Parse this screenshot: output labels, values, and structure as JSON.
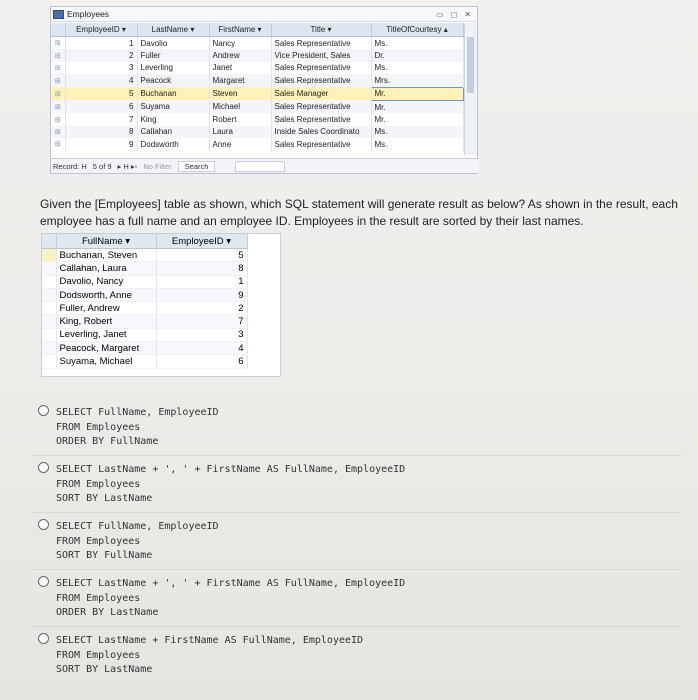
{
  "access": {
    "window_title": "Employees",
    "columns": [
      "EmployeeID",
      "LastName",
      "FirstName",
      "Title",
      "TitleOfCourtesy"
    ],
    "rows": [
      {
        "id": "1",
        "last": "Davolio",
        "first": "Nancy",
        "title": "Sales Representative",
        "courtesy": "Ms."
      },
      {
        "id": "2",
        "last": "Fuller",
        "first": "Andrew",
        "title": "Vice President, Sales",
        "courtesy": "Dr."
      },
      {
        "id": "3",
        "last": "Leverling",
        "first": "Janet",
        "title": "Sales Representative",
        "courtesy": "Ms."
      },
      {
        "id": "4",
        "last": "Peacock",
        "first": "Margaret",
        "title": "Sales Representative",
        "courtesy": "Mrs."
      },
      {
        "id": "5",
        "last": "Buchanan",
        "first": "Steven",
        "title": "Sales Manager",
        "courtesy": "Mr."
      },
      {
        "id": "6",
        "last": "Suyama",
        "first": "Michael",
        "title": "Sales Representative",
        "courtesy": "Mr."
      },
      {
        "id": "7",
        "last": "King",
        "first": "Robert",
        "title": "Sales Representative",
        "courtesy": "Mr."
      },
      {
        "id": "8",
        "last": "Callahan",
        "first": "Laura",
        "title": "Inside Sales Coordinato",
        "courtesy": "Ms."
      },
      {
        "id": "9",
        "last": "Dodsworth",
        "first": "Anne",
        "title": "Sales Representative",
        "courtesy": "Ms."
      }
    ],
    "status": {
      "record_label": "Record: H",
      "position": "5 of 9",
      "nav": "▸ H ▸▫",
      "no_filter": "No Filter",
      "search": "Search"
    }
  },
  "question": "Given the [Employees] table as shown, which SQL statement will generate result as below? As shown in the result, each employee has a full name and an employee ID. Employees in the result are sorted by their last names.",
  "result": {
    "columns": [
      "FullName",
      "EmployeeID"
    ],
    "rows": [
      {
        "name": "Buchanan, Steven",
        "id": "5"
      },
      {
        "name": "Callahan, Laura",
        "id": "8"
      },
      {
        "name": "Davolio, Nancy",
        "id": "1"
      },
      {
        "name": "Dodsworth, Anne",
        "id": "9"
      },
      {
        "name": "Fuller, Andrew",
        "id": "2"
      },
      {
        "name": "King, Robert",
        "id": "7"
      },
      {
        "name": "Leverling, Janet",
        "id": "3"
      },
      {
        "name": "Peacock, Margaret",
        "id": "4"
      },
      {
        "name": "Suyama, Michael",
        "id": "6"
      }
    ]
  },
  "options": [
    {
      "lines": [
        "SELECT FullName, EmployeeID",
        "FROM Employees",
        "ORDER BY FullName"
      ]
    },
    {
      "lines": [
        "SELECT LastName + ', ' + FirstName AS FullName, EmployeeID",
        "FROM Employees",
        "SORT BY LastName"
      ]
    },
    {
      "lines": [
        "SELECT FullName, EmployeeID",
        "FROM Employees",
        "SORT BY FullName"
      ]
    },
    {
      "lines": [
        "SELECT LastName + ', ' + FirstName AS FullName, EmployeeID",
        "FROM Employees",
        "ORDER BY LastName"
      ]
    },
    {
      "lines": [
        "SELECT LastName + FirstName AS FullName, EmployeeID",
        "FROM Employees",
        "SORT BY LastName"
      ]
    }
  ]
}
